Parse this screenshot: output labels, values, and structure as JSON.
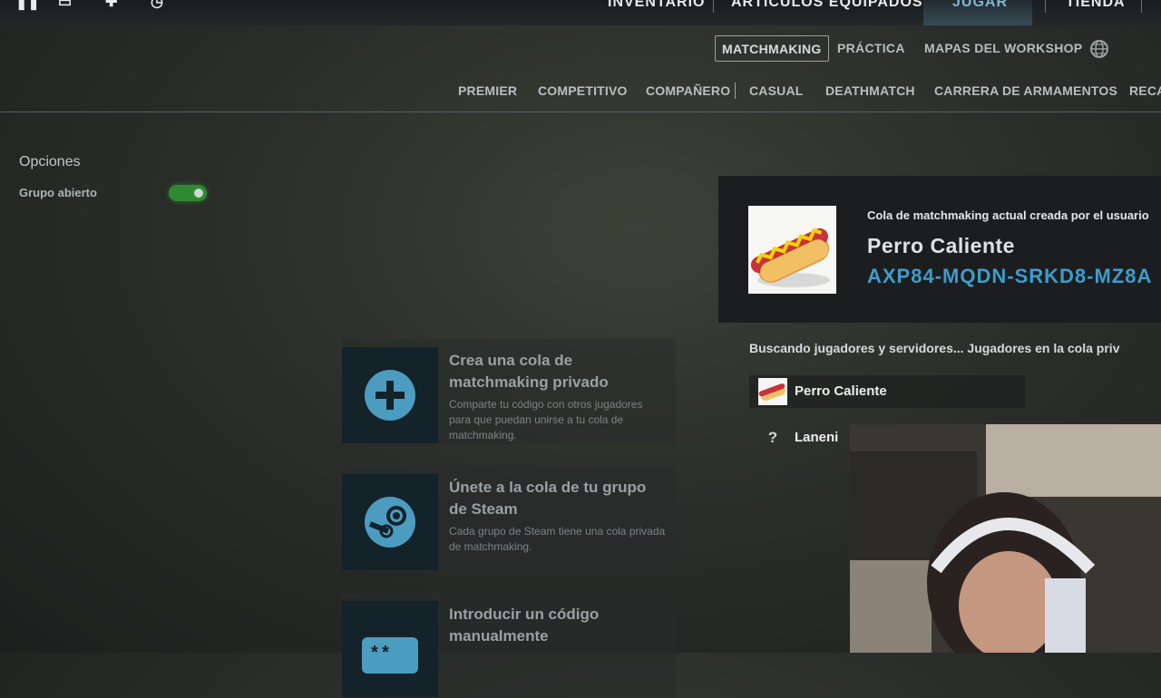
{
  "top_nav": {
    "items": [
      "INVENTARIO",
      "ARTÍCULOS EQUIPADOS",
      "JUGAR",
      "TIENDA"
    ],
    "active": "JUGAR"
  },
  "sub_nav": {
    "items": [
      "MATCHMAKING",
      "PRÁCTICA",
      "MAPAS DEL WORKSHOP"
    ],
    "active": "MATCHMAKING",
    "globe_icon": "globe-icon"
  },
  "modes": [
    "PREMIER",
    "COMPETITIVO",
    "COMPAÑERO",
    "CASUAL",
    "DEATHMATCH",
    "CARRERA DE ARMAMENTOS",
    "RECA"
  ],
  "options": {
    "title": "Opciones",
    "open_group_label": "Grupo abierto",
    "open_group_on": true
  },
  "cards": [
    {
      "icon": "plus-icon",
      "title": "Crea una cola de matchmaking privado",
      "desc": "Comparte tu código con otros jugadores para que puedan unirse a tu cola de matchmaking."
    },
    {
      "icon": "steam-icon",
      "title": "Únete a la cola de tu grupo de Steam",
      "desc": "Cada grupo de Steam tiene una cola privada de matchmaking."
    },
    {
      "icon": "keypad-icon",
      "title": "Introducir un código manualmente",
      "desc": ""
    }
  ],
  "queue": {
    "creator_label": "Cola de matchmaking actual creada por el usuario",
    "name": "Perro Caliente",
    "code": "AXP84-MQDN-SRKD8-MZ8A",
    "status": "Buscando jugadores y servidores... Jugadores en la cola priv",
    "players": [
      {
        "name": "Perro Caliente",
        "avatar": "hotdog-avatar"
      },
      {
        "name": "Laneni",
        "avatar": "?"
      }
    ]
  },
  "colors": {
    "accent": "#3e9ccc",
    "toggle_on": "#2f8a33"
  }
}
